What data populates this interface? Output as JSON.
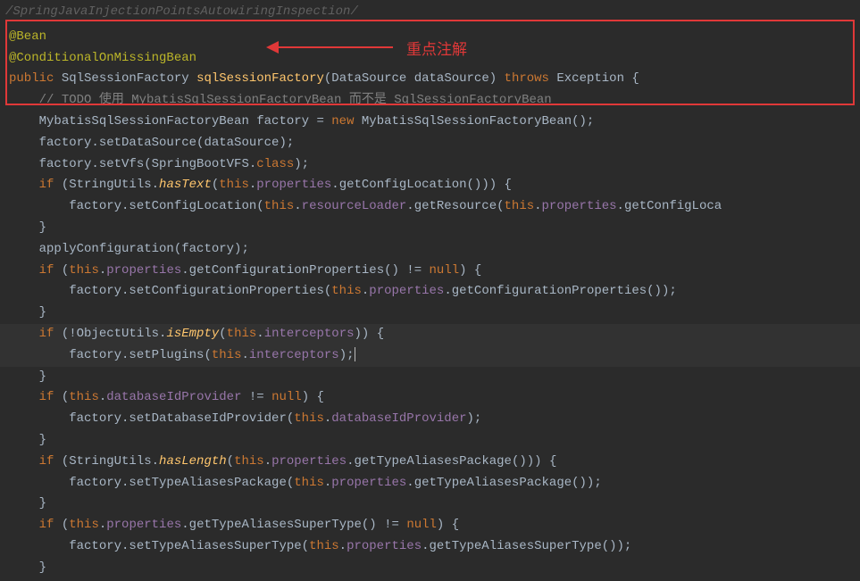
{
  "breadcrumb": "/SpringJavaInjectionPointsAutowiringInspection/",
  "highlight_label": "重点注解",
  "code": {
    "l1_ann1": "@Bean",
    "l2_ann2": "@ConditionalOnMissingBean",
    "l3_kw_public": "public",
    "l3_type1": " SqlSessionFactory ",
    "l3_method": "sqlSessionFactory",
    "l3_paren_open": "(",
    "l3_type2": "DataSource dataSource",
    "l3_paren_close": ") ",
    "l3_kw_throws": "throws",
    "l3_type3": " Exception {",
    "l4_indent": "    ",
    "l4_comment": "// TODO 使用 MybatisSqlSessionFactoryBean 而不是 SqlSessionFactoryBean",
    "l5_indent": "    ",
    "l5_text1": "MybatisSqlSessionFactoryBean factory = ",
    "l5_kw_new": "new",
    "l5_text2": " MybatisSqlSessionFactoryBean();",
    "l6_indent": "    ",
    "l6_text": "factory.setDataSource(dataSource);",
    "l7_indent": "    ",
    "l7_text1": "factory.setVfs(SpringBootVFS.",
    "l7_kw_class": "class",
    "l7_text2": ");",
    "l8_indent": "    ",
    "l8_kw_if": "if",
    "l8_text1": " (StringUtils.",
    "l8_method": "hasText",
    "l8_text2": "(",
    "l8_kw_this1": "this",
    "l8_text3": ".",
    "l8_field1": "properties",
    "l8_text4": ".getConfigLocation())) {",
    "l9_indent": "        ",
    "l9_text1": "factory.setConfigLocation(",
    "l9_kw_this": "this",
    "l9_text2": ".",
    "l9_field1": "resourceLoader",
    "l9_text3": ".getResource(",
    "l9_kw_this2": "this",
    "l9_text4": ".",
    "l9_field2": "properties",
    "l9_text5": ".getConfigLoca",
    "l10_indent": "    ",
    "l10_text": "}",
    "l11_indent": "    ",
    "l11_text": "applyConfiguration(factory);",
    "l12_indent": "    ",
    "l12_kw_if": "if",
    "l12_text1": " (",
    "l12_kw_this": "this",
    "l12_text2": ".",
    "l12_field": "properties",
    "l12_text3": ".getConfigurationProperties() != ",
    "l12_kw_null": "null",
    "l12_text4": ") {",
    "l13_indent": "        ",
    "l13_text1": "factory.setConfigurationProperties(",
    "l13_kw_this": "this",
    "l13_text2": ".",
    "l13_field": "properties",
    "l13_text3": ".getConfigurationProperties());",
    "l14_indent": "    ",
    "l14_text": "}",
    "l15_indent": "    ",
    "l15_kw_if": "if",
    "l15_text1": " (!ObjectUtils.",
    "l15_method": "isEmpty",
    "l15_text2": "(",
    "l15_kw_this": "this",
    "l15_text3": ".",
    "l15_field": "interceptors",
    "l15_text4": ")) {",
    "l16_indent": "        ",
    "l16_text1": "factory.setPlugins(",
    "l16_kw_this": "this",
    "l16_text2": ".",
    "l16_field": "interceptors",
    "l16_text3": ");",
    "l17_indent": "    ",
    "l17_text": "}",
    "l18_indent": "    ",
    "l18_kw_if": "if",
    "l18_text1": " (",
    "l18_kw_this": "this",
    "l18_text2": ".",
    "l18_field": "databaseIdProvider",
    "l18_text3": " != ",
    "l18_kw_null": "null",
    "l18_text4": ") {",
    "l19_indent": "        ",
    "l19_text1": "factory.setDatabaseIdProvider(",
    "l19_kw_this": "this",
    "l19_text2": ".",
    "l19_field": "databaseIdProvider",
    "l19_text3": ");",
    "l20_indent": "    ",
    "l20_text": "}",
    "l21_indent": "    ",
    "l21_kw_if": "if",
    "l21_text1": " (StringUtils.",
    "l21_method": "hasLength",
    "l21_text2": "(",
    "l21_kw_this": "this",
    "l21_text3": ".",
    "l21_field": "properties",
    "l21_text4": ".getTypeAliasesPackage())) {",
    "l22_indent": "        ",
    "l22_text1": "factory.setTypeAliasesPackage(",
    "l22_kw_this": "this",
    "l22_text2": ".",
    "l22_field": "properties",
    "l22_text3": ".getTypeAliasesPackage());",
    "l23_indent": "    ",
    "l23_text": "}",
    "l24_indent": "    ",
    "l24_kw_if": "if",
    "l24_text1": " (",
    "l24_kw_this": "this",
    "l24_text2": ".",
    "l24_field": "properties",
    "l24_text3": ".getTypeAliasesSuperType() != ",
    "l24_kw_null": "null",
    "l24_text4": ") {",
    "l25_indent": "        ",
    "l25_text1": "factory.setTypeAliasesSuperType(",
    "l25_kw_this": "this",
    "l25_text2": ".",
    "l25_field": "properties",
    "l25_text3": ".getTypeAliasesSuperType());",
    "l26_indent": "    ",
    "l26_text": "}"
  }
}
